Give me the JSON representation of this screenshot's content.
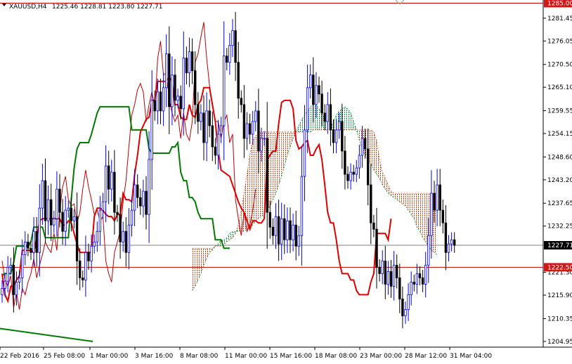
{
  "header": {
    "symbol": "XAUUSD,H4",
    "ohlc": "1225.46 1228.81 1223.80 1227.71"
  },
  "colors": {
    "bull_candle": "#0000ff",
    "bear_candle": "#000000",
    "tenkan": "#e00000",
    "kijun": "#007a00",
    "chikou": "#c00000",
    "cloud_bull_dot": "#008f3a",
    "cloud_bear_dot": "#d04010",
    "hline": "#c00000",
    "current_line": "#808080",
    "tag_red_bg": "#d01818",
    "tag_black_bg": "#000000",
    "tag_text": "#ffffff"
  },
  "chart_data": {
    "type": "candlestick",
    "ylim": [
      1203.6,
      1285.75
    ],
    "yticks": [
      "1281.45",
      "1276.05",
      "1270.50",
      "1265.10",
      "1259.55",
      "1254.15",
      "1248.60",
      "1243.20",
      "1237.65",
      "1232.25",
      "1221.30",
      "1215.90",
      "1210.35",
      "1204.95"
    ],
    "xticks": [
      "22 Feb 2016",
      "25 Feb 08:00",
      "1 Mar 00:00",
      "3 Mar 16:00",
      "8 Mar 08:00",
      "11 Mar 00:00",
      "15 Mar 16:00",
      "18 Mar 08:00",
      "23 Mar 00:00",
      "28 Mar 12:00",
      "31 Mar 04:00"
    ],
    "hlines": [
      {
        "label": "1285.00",
        "value": 1285.0
      },
      {
        "label": "1222.50",
        "value": 1222.5
      }
    ],
    "current": {
      "label": "1227.71",
      "value": 1227.71
    },
    "series": {
      "close": [
        1217.5,
        1219.2,
        1222.5,
        1223.0,
        1216.0,
        1219.0,
        1220.0,
        1225.5,
        1228.5,
        1227.0,
        1226.0,
        1231.0,
        1226.0,
        1236.5,
        1243.0,
        1233.5,
        1238.5,
        1232.5,
        1234.0,
        1241.0,
        1235.5,
        1231.0,
        1236.0,
        1236.5,
        1233.5,
        1234.5,
        1224.0,
        1220.0,
        1219.5,
        1226.0,
        1224.0,
        1227.5,
        1228.5,
        1231.0,
        1236.0,
        1238.0,
        1246.5,
        1241.0,
        1245.0,
        1235.5,
        1235.0,
        1228.5,
        1231.0,
        1226.0,
        1232.5,
        1236.0,
        1242.0,
        1239.0,
        1237.0,
        1240.5,
        1235.0,
        1248.0,
        1262.0,
        1259.5,
        1264.0,
        1259.5,
        1265.0,
        1273.0,
        1260.5,
        1268.0,
        1262.0,
        1263.0,
        1260.0,
        1272.0,
        1268.5,
        1273.5,
        1269.0,
        1261.0,
        1257.0,
        1259.0,
        1252.0,
        1259.5,
        1256.0,
        1251.0,
        1249.0,
        1254.0,
        1256.0,
        1272.5,
        1271.0,
        1275.0,
        1278.5,
        1271.0,
        1262.5,
        1261.0,
        1253.0,
        1256.5,
        1254.0,
        1257.0,
        1259.5,
        1250.0,
        1253.0,
        1253.0,
        1235.5,
        1232.0,
        1230.0,
        1234.5,
        1228.0,
        1234.0,
        1229.0,
        1233.5,
        1229.0,
        1232.5,
        1227.5,
        1230.0,
        1244.0,
        1255.0,
        1265.0,
        1268.0,
        1261.0,
        1265.5,
        1263.5,
        1259.0,
        1257.0,
        1261.0,
        1255.0,
        1252.0,
        1255.0,
        1257.0,
        1250.0,
        1244.5,
        1243.0,
        1245.0,
        1244.5,
        1246.0,
        1249.0,
        1253.0,
        1250.5,
        1242.0,
        1233.0,
        1231.5,
        1222.5,
        1221.0,
        1224.0,
        1218.5,
        1221.5,
        1218.0,
        1223.0,
        1220.0,
        1215.0,
        1211.0,
        1212.5,
        1216.0,
        1219.0,
        1218.5,
        1221.0,
        1220.0,
        1218.5,
        1223.0,
        1230.0,
        1240.0,
        1236.0,
        1242.0,
        1236.0,
        1233.0,
        1226.0,
        1228.0,
        1229.0,
        1227.71
      ],
      "tenkan": [
        1221.0,
        1216.0,
        1214.5,
        1218.0,
        1218.0,
        1219.5,
        1220.5,
        1226.5,
        1226.5,
        1226.5,
        1226.5,
        1226.0,
        1229.5,
        1233.5,
        1234.0,
        1234.0,
        1234.0,
        1234.0,
        1234.0,
        1234.0,
        1234.0,
        1232.5,
        1232.5,
        1233.5,
        1233.0,
        1230.5,
        1228.0,
        1226.0,
        1226.0,
        1226.0,
        1226.0,
        1226.0,
        1234.5,
        1236.5,
        1236.5,
        1236.0,
        1235.0,
        1234.5,
        1234.5,
        1233.5,
        1235.0,
        1235.0,
        1240.0,
        1238.5,
        1238.5,
        1238.0,
        1244.5,
        1249.0,
        1254.5,
        1256.0,
        1257.5,
        1258.0,
        1262.0,
        1262.0,
        1266.5,
        1266.5,
        1266.5,
        1266.5,
        1267.5,
        1266.5,
        1261.0,
        1261.0,
        1258.0,
        1257.5,
        1257.5,
        1261.0,
        1258.5,
        1258.0,
        1261.0,
        1262.0,
        1265.0,
        1265.0,
        1265.0,
        1261.0,
        1257.0,
        1250.0,
        1245.5,
        1245.0,
        1244.5,
        1244.0,
        1242.0,
        1240.0,
        1238.0,
        1236.5,
        1235.5,
        1233.5,
        1231.5,
        1233.5,
        1233.5,
        1233.0,
        1233.0,
        1234.0,
        1248.0,
        1249.0,
        1250.0,
        1250.0,
        1256.5,
        1261.5,
        1262.0,
        1262.0,
        1262.0,
        1260.0,
        1252.5,
        1250.5,
        1251.0,
        1252.0,
        1252.5,
        1249.0,
        1249.0,
        1250.5,
        1251.5,
        1248.0,
        1242.0,
        1235.5,
        1233.0,
        1233.0,
        1229.0,
        1224.0,
        1221.0,
        1221.0,
        1221.0,
        1219.5,
        1219.5,
        1217.0,
        1216.0,
        1216.0,
        1216.0,
        1216.0,
        1219.0,
        1221.0,
        1230.5,
        1230.5,
        1230.5,
        1230.5,
        1229.0,
        1234.0
      ],
      "kijun": [
        1220.5,
        1221.0,
        1221.0,
        1221.0,
        1223.5,
        1227.5,
        1227.5,
        1227.5,
        1227.5,
        1227.5,
        1228.5,
        1232.0,
        1232.0,
        1232.0,
        1232.0,
        1229.5,
        1229.5,
        1229.5,
        1229.5,
        1229.5,
        1229.5,
        1229.5,
        1229.5,
        1229.5,
        1238.5,
        1246.0,
        1250.5,
        1252.0,
        1252.0,
        1252.0,
        1252.0,
        1254.0,
        1256.5,
        1259.0,
        1260.5,
        1260.5,
        1260.5,
        1260.5,
        1260.5,
        1260.5,
        1260.5,
        1260.5,
        1260.5,
        1260.5,
        1260.5,
        1255.0,
        1255.0,
        1255.0,
        1255.0,
        1255.0,
        1255.0,
        1250.5,
        1249.5,
        1249.5,
        1249.5,
        1249.5,
        1249.5,
        1249.5,
        1249.5,
        1251.0,
        1251.0,
        1252.0,
        1245.0,
        1243.0,
        1243.0,
        1239.0,
        1239.0,
        1238.0,
        1235.5,
        1234.0,
        1234.0,
        1234.0,
        1234.0,
        1234.0,
        1229.0,
        1229.0,
        1229.0,
        1227.0,
        1227.0,
        1227.0
      ],
      "chikou": [
        1224.0,
        1219.5,
        1218.0,
        1220.5,
        1213.0,
        1216.5,
        1212.5,
        1217.5,
        1216.0,
        1219.0,
        1221.0,
        1224.5,
        1220.0,
        1223.0,
        1225.5,
        1228.5,
        1227.0,
        1226.0,
        1230.5,
        1226.5,
        1236.0,
        1241.5,
        1244.0,
        1238.5,
        1237.0,
        1237.5,
        1233.0,
        1235.5,
        1241.0,
        1245.5,
        1241.5,
        1238.5,
        1235.0,
        1236.0,
        1233.5,
        1234.5,
        1224.0,
        1221.0,
        1219.0,
        1226.0,
        1228.5,
        1231.0,
        1238.0,
        1243.0,
        1251.0,
        1258.5,
        1261.0,
        1264.5,
        1266.0,
        1264.0,
        1257.0,
        1261.0,
        1264.0,
        1260.5,
        1272.0,
        1276.0,
        1268.0,
        1268.5,
        1262.5,
        1259.0,
        1257.0,
        1258.5,
        1253.0,
        1259.0,
        1254.0,
        1252.5,
        1257.0,
        1271.0,
        1273.0,
        1277.0,
        1280.5,
        1272.0,
        1265.5,
        1260.5,
        1257.0,
        1257.0,
        1253.0,
        1257.0,
        1258.5,
        1252.0,
        1254.0,
        1238.5,
        1234.0,
        1230.0,
        1235.5,
        1231.0,
        1232.5,
        1236.0,
        1241.0
      ],
      "spanA": [
        1217.0,
        1218.0,
        1219.5,
        1221.0,
        1223.0,
        1224.5,
        1226.0,
        1226.5,
        1227.5,
        1228.0,
        1229.0,
        1229.0,
        1229.5,
        1230.5,
        1231.0,
        1231.0,
        1231.0,
        1231.0,
        1231.0,
        1231.5,
        1232.0,
        1232.5,
        1233.5,
        1234.0,
        1234.5,
        1235.0,
        1236.0,
        1237.0,
        1238.5,
        1240.0,
        1242.0,
        1244.0,
        1246.5,
        1249.0,
        1251.0,
        1253.0,
        1254.5,
        1256.0,
        1257.5,
        1258.5,
        1259.5,
        1260.5,
        1261.0,
        1261.0,
        1260.0,
        1259.0,
        1257.5,
        1256.5,
        1256.0,
        1257.0,
        1258.5,
        1259.5,
        1260.0,
        1260.5,
        1260.0,
        1259.0,
        1257.0,
        1255.0,
        1252.5,
        1250.5,
        1249.0,
        1248.0,
        1247.0,
        1245.5,
        1244.5,
        1243.5,
        1242.0,
        1241.0,
        1240.0,
        1239.5,
        1239.0,
        1238.5,
        1238.0,
        1237.5,
        1237.0,
        1236.0,
        1235.0,
        1234.0,
        1232.0,
        1231.0,
        1229.5,
        1228.5,
        1227.5,
        1226.5,
        1226.0,
        1225.5
      ],
      "spanB": [
        1227.0,
        1227.0,
        1227.0,
        1227.0,
        1227.0,
        1227.0,
        1227.0,
        1227.0,
        1227.5,
        1227.5,
        1227.5,
        1228.0,
        1228.5,
        1229.0,
        1229.5,
        1230.5,
        1232.5,
        1236.0,
        1240.0,
        1244.5,
        1249.0,
        1252.5,
        1253.5,
        1254.5,
        1254.5,
        1254.5,
        1254.5,
        1254.5,
        1254.5,
        1254.5,
        1254.5,
        1254.5,
        1254.5,
        1254.5,
        1254.5,
        1254.5,
        1254.5,
        1254.5,
        1254.5,
        1254.5,
        1254.5,
        1254.5,
        1255.0,
        1255.0,
        1255.0,
        1255.0,
        1255.0,
        1255.0,
        1255.0,
        1255.0,
        1255.0,
        1255.0,
        1255.0,
        1255.0,
        1255.0,
        1255.0,
        1255.0,
        1255.0,
        1255.0,
        1255.0,
        1255.0,
        1255.0,
        1255.0,
        1254.5,
        1252.5,
        1248.0,
        1245.0,
        1243.5,
        1242.0,
        1240.5,
        1240.0,
        1240.0,
        1240.0,
        1240.0,
        1240.0,
        1240.0,
        1240.0,
        1240.0,
        1240.0,
        1240.0,
        1240.0,
        1240.0,
        1240.0,
        1240.0,
        1240.0,
        1240.0
      ],
      "lower_trend": [
        1208.0,
        1204.95
      ]
    }
  }
}
